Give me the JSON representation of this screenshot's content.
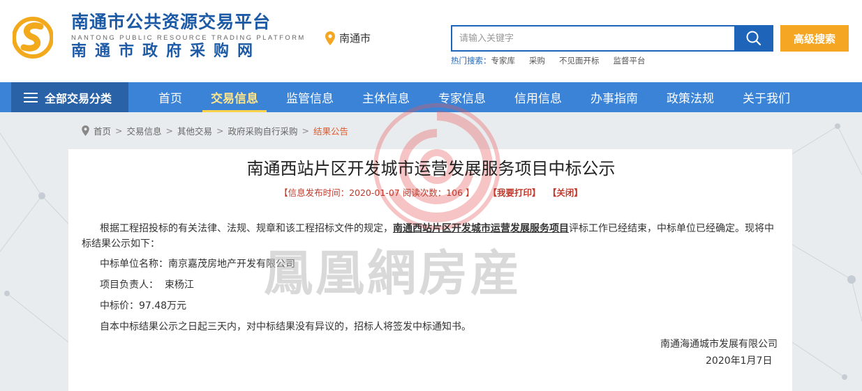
{
  "header": {
    "title_cn": "南通市公共资源交易平台",
    "title_en": "NANTONG PUBLIC RESOURCE TRADING PLATFORM",
    "subtitle_cn": "南通市政府采购网",
    "location": "南通市",
    "search_placeholder": "请输入关键字",
    "advanced_search_label": "高级搜索",
    "hot_label": "热门搜索：",
    "hot_items": [
      "专家库",
      "采购",
      "不见面开标",
      "监督平台"
    ]
  },
  "nav": {
    "all_label": "全部交易分类",
    "items": [
      "首页",
      "交易信息",
      "监管信息",
      "主体信息",
      "专家信息",
      "信用信息",
      "办事指南",
      "政策法规",
      "关于我们"
    ],
    "active_index": 1
  },
  "breadcrumb": [
    "首页",
    "交易信息",
    "其他交易",
    "政府采购自行采购",
    "结果公告"
  ],
  "article": {
    "title": "南通西站片区开发城市运营发展服务项目中标公示",
    "meta_prefix": "【信息发布时间：2020-01-07 阅读次数：106 】",
    "print_label": "【我要打印】",
    "close_label": "【关闭】",
    "para1_before": "根据工程招投标的有关法律、法规、规章和该工程招标文件的规定，",
    "para1_highlight": "南通西站片区开发城市运营发展服务项目",
    "para1_after": "评标工作已经结束，中标单位已经确定。现将中标结果公示如下：",
    "winner_line": "中标单位名称：南京嘉茂房地产开发有限公司",
    "manager_line": "项目负责人：  束杨江",
    "price_line": "中标价：97.48万元",
    "notice_line": "自本中标结果公示之日起三天内，对中标结果没有异议的，招标人将签发中标通知书。",
    "signature_org": "南通海通城市发展有限公司",
    "signature_date": "2020年1月7日"
  },
  "watermark": {
    "text": "鳳凰網房産"
  },
  "colors": {
    "brand_blue": "#1d5aa6",
    "nav_blue": "#3b83d6",
    "accent_orange": "#f5a623",
    "meta_red": "#c0392b"
  }
}
